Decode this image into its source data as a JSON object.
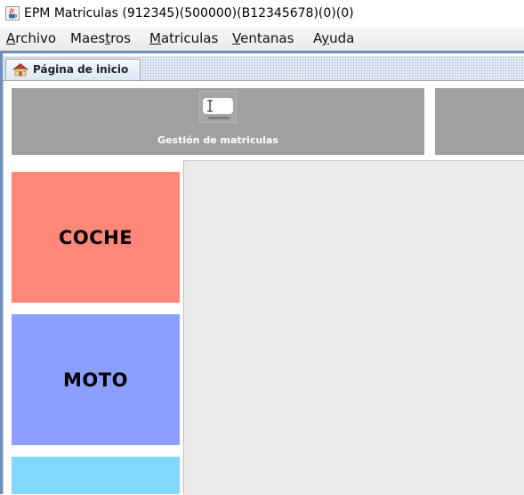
{
  "window": {
    "title": "EPM Matriculas (912345)(500000)(B12345678)(0)(0)",
    "icon": "java-cup-icon"
  },
  "menubar": {
    "items": [
      {
        "pre": "",
        "u": "A",
        "post": "rchivo"
      },
      {
        "pre": "Maes",
        "u": "t",
        "post": "ros"
      },
      {
        "pre": "",
        "u": "M",
        "post": "atriculas"
      },
      {
        "pre": "",
        "u": "V",
        "post": "entanas"
      },
      {
        "pre": "A",
        "u": "y",
        "post": "uda"
      }
    ]
  },
  "tab": {
    "label": "Página de inicio",
    "icon": "home-icon"
  },
  "toolbar": {
    "gestion_label": "Gestión de matriculas",
    "gestion_icon": "license-plate-icon",
    "card_color": "#a0a0a0"
  },
  "vehicles": [
    {
      "label": "COCHE",
      "color": "#ff8878"
    },
    {
      "label": "MOTO",
      "color": "#8c9eff"
    },
    {
      "label": "",
      "color": "#80d8ff"
    }
  ]
}
